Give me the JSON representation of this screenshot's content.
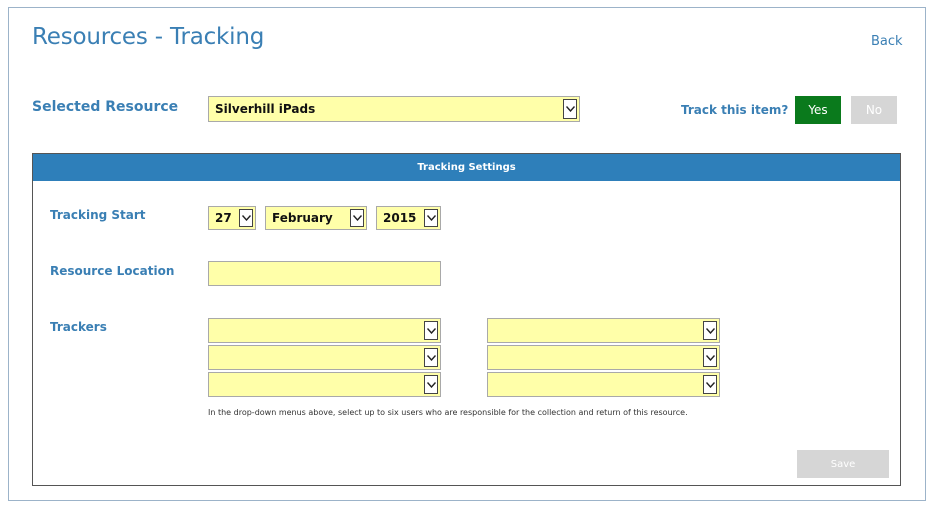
{
  "page": {
    "title": "Resources - Tracking",
    "back_label": "Back"
  },
  "resource": {
    "label": "Selected Resource",
    "value": "Silverhill iPads"
  },
  "track": {
    "label": "Track this item?",
    "yes_label": "Yes",
    "no_label": "No"
  },
  "panel": {
    "title": "Tracking Settings"
  },
  "tracking_start": {
    "label": "Tracking Start",
    "day": "27",
    "month": "February",
    "year": "2015"
  },
  "location": {
    "label": "Resource Location",
    "value": ""
  },
  "trackers": {
    "label": "Trackers",
    "values": [
      "",
      "",
      "",
      "",
      "",
      ""
    ],
    "help": "In the drop-down menus above, select up to six users who are responsible for the collection and return of this resource."
  },
  "save_label": "Save",
  "colors": {
    "accent": "#3a7fb4",
    "header": "#2e7fba",
    "field_bg": "#ffffa9",
    "yes_bg": "#0a7a1c",
    "disabled_bg": "#d6d6d6"
  },
  "icons": {
    "dropdown": "chevron-down-icon"
  }
}
